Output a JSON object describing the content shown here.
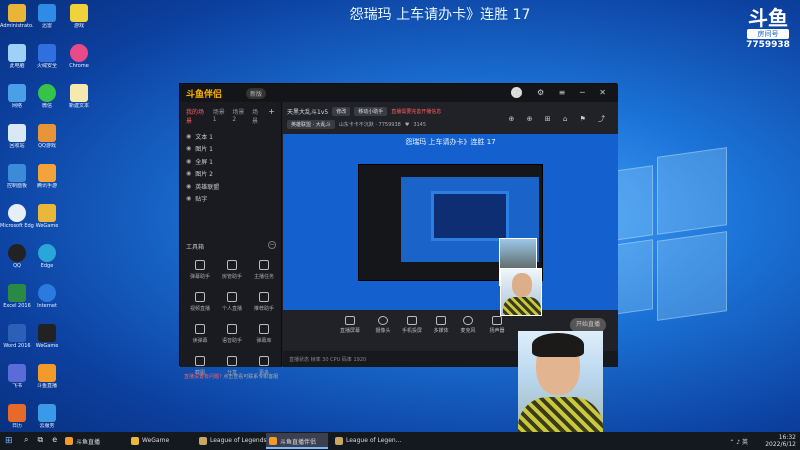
{
  "overlay": {
    "stream_title": "怨瑞玛 上车请办卡》连胜 17",
    "room_logo": "斗鱼",
    "room_tag": "房间号",
    "room_number": "7759938"
  },
  "desktop_icons": {
    "col1": [
      "Administrato...",
      "此电脑",
      "网络",
      "回收站",
      "控制面板",
      "Microsoft Edge",
      "QQ",
      "Excel 2016",
      "Word 2016",
      "飞书",
      "日历"
    ],
    "col2": [
      "迅雷",
      "火绒安全",
      "微信",
      "QQ游戏",
      "腾讯手游",
      "WeGame",
      "Edge",
      "Internet",
      "WeGame",
      "斗鱼直播",
      "云服务"
    ],
    "col3": [
      "游戏",
      "Chrome",
      "新建文本",
      "",
      "",
      "",
      "",
      "",
      "",
      "",
      ""
    ]
  },
  "app": {
    "logo": "斗鱼伴侣",
    "version": "新版",
    "window_controls": "◻ ⚙ ≡ ─ ✕",
    "tabs": [
      "我的场景",
      "场景1",
      "场景2",
      "场景"
    ],
    "sources": [
      "文本 1",
      "图片 1",
      "全屏 1",
      "图片 2",
      "英雄联盟",
      "贴字"
    ],
    "tools_title": "工具箱",
    "tools": [
      "弹幕助手",
      "房管助手",
      "主播任务",
      "视频直播",
      "个人直播",
      "推荐助手",
      "读弹幕",
      "语音助手",
      "弹幕库",
      "截图",
      "分享",
      "更多"
    ],
    "notice_prefix": "直播设置有问题?",
    "notice_rest": "点击查看可联系专职客服",
    "room_name": "天黑大乱斗1v5",
    "chip1": "修改",
    "chip2": "移动小助手",
    "warn": "直播需要完善开播信息",
    "category_chip": "英雄联盟 · 大乱斗",
    "room_info": "山东卡卡不沉默 · 7759938",
    "fans": "3145",
    "toolbar_icons": "⊕ ⊕ ⊞ ⌂ ⚑ ⤴",
    "preview_title": "怨瑞玛 上车请办卡》连胜 17",
    "bottom_items": [
      "直播屏幕",
      "摄像头",
      "手机投屏",
      "多媒体",
      "麦克风",
      "扬声器"
    ],
    "start_button": "开始直播",
    "status": "直播状态   帧率 30   CPU   码率   1920"
  },
  "taskbar": {
    "tasks": [
      "斗鱼直播",
      "WeGame",
      "League of Legends",
      "斗鱼直播伴侣",
      "League of Legen..."
    ],
    "time": "16:32",
    "date": "2022/6/12",
    "tray": "⌃ ♪ 英"
  }
}
